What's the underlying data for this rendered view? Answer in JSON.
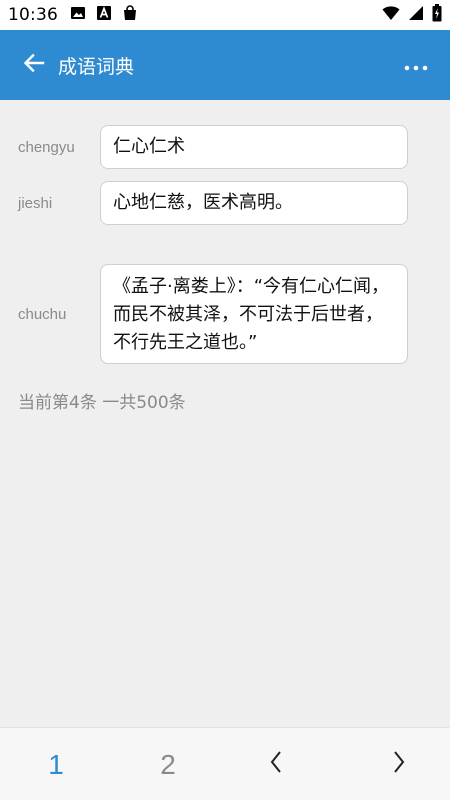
{
  "status_bar": {
    "time": "10:36",
    "left_icons": [
      "image-icon",
      "a-letter-icon",
      "shopping-bag-icon"
    ],
    "right_icons": [
      "wifi-icon",
      "signal-icon",
      "battery-icon"
    ]
  },
  "app_bar": {
    "title": "成语词典",
    "back_icon": "arrow-left-icon",
    "more_icon": "more-horizontal-icon",
    "color": "#2e8bd2"
  },
  "form": {
    "chengyu": {
      "label": "chengyu",
      "value": "仁心仁术"
    },
    "jieshi": {
      "label": "jieshi",
      "value": "心地仁慈，医术高明。"
    },
    "chuchu": {
      "label": "chuchu",
      "value": "《孟子·离娄上》：“今有仁心仁闻，而民不被其泽，不可法于后世者，不行先王之道也。”"
    }
  },
  "counter": "当前第4条 一共500条",
  "bottom_nav": {
    "page1": "1",
    "page2": "2",
    "prev": "‹",
    "next": "›",
    "active_color": "#2e8bd2",
    "inactive_color": "#8a8a8a"
  }
}
